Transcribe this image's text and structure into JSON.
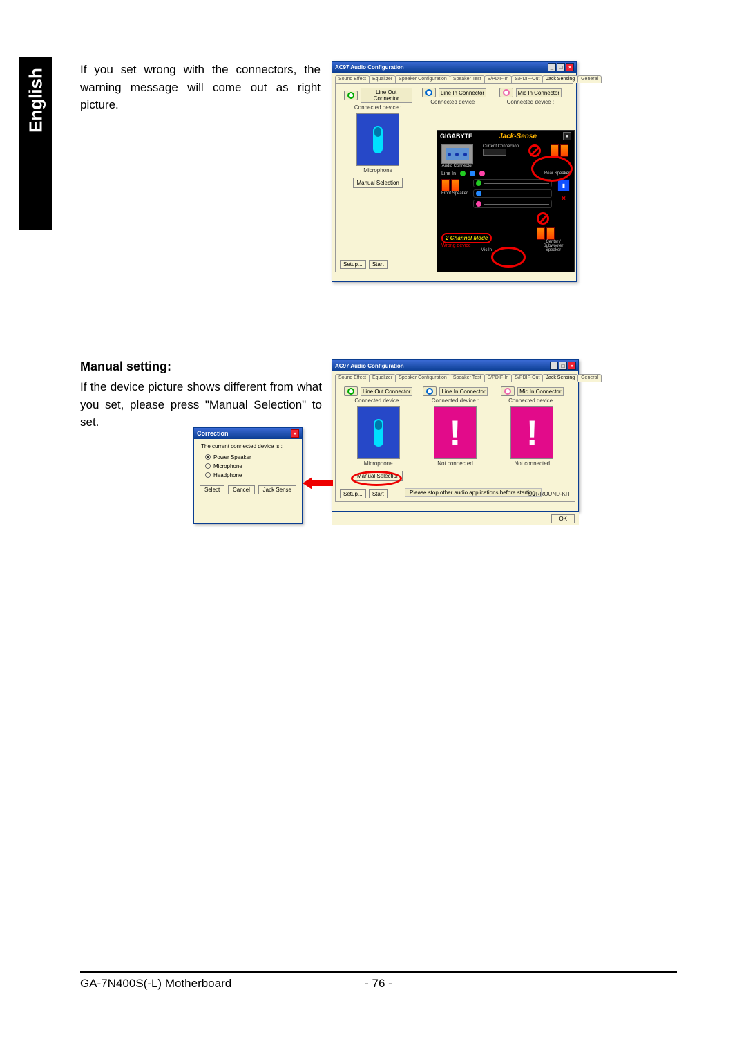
{
  "language_tab": "English",
  "section1": {
    "text": "If you set wrong with the connectors, the warning message will come out as right picture."
  },
  "section2": {
    "title": "Manual setting:",
    "text": "If the device picture shows different from what you set, please press \"Manual Selection\" to set."
  },
  "ac97": {
    "window_title": "AC97 Audio Configuration",
    "tabs": [
      "Sound Effect",
      "Equalizer",
      "Speaker Configuration",
      "Speaker Test",
      "S/PDIF-In",
      "S/PDIF-Out",
      "Jack Sensing",
      "General"
    ],
    "active_tab": "Jack Sensing",
    "connectors": {
      "line_out": "Line Out Connector",
      "line_in": "Line In Connector",
      "mic_in": "Mic In Connector"
    },
    "connected_label": "Connected device :",
    "device_mic": "Microphone",
    "device_not": "Not connected",
    "manual_selection": "Manual Selection",
    "setup": "Setup...",
    "start": "Start",
    "stop_msg": "Please stop other audio applications before starting.",
    "surround": "SURROUND-KIT",
    "ok": "OK"
  },
  "jack_sense": {
    "brand": "GIGABYTE",
    "title": "Jack-Sense",
    "audio_connector": "Audio Connector",
    "current": "Current Connection",
    "line_in": "Line In",
    "rear": "Rear Speaker",
    "front": "Front Speaker",
    "mic_in": "Mic In",
    "mode": "2 Channel Mode",
    "wrong": "Wrong device",
    "center": "Center / Subwoofer Speaker"
  },
  "correction": {
    "title": "Correction",
    "msg": "The current connected device is :",
    "opt1": "Power Speaker",
    "opt2": "Microphone",
    "opt3": "Headphone",
    "select": "Select",
    "cancel": "Cancel",
    "jack_sense": "Jack Sense"
  },
  "footer": {
    "product": "GA-7N400S(-L) Motherboard",
    "page": "- 76 -"
  }
}
